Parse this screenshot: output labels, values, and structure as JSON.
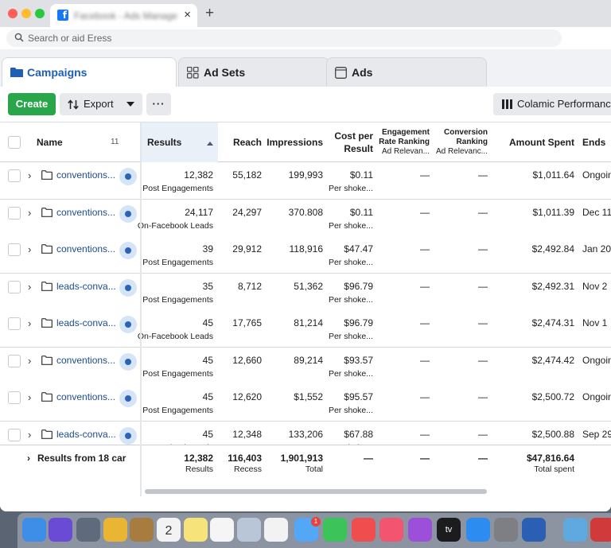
{
  "browser": {
    "tab_title": "Facebook - Ads Manager",
    "new_tab": "+",
    "close": "×",
    "address_placeholder": "Search or aid Eress"
  },
  "nav_tabs": [
    {
      "label": "Campaigns",
      "active": true
    },
    {
      "label": "Ad Sets",
      "active": false
    },
    {
      "label": "Ads",
      "active": false
    }
  ],
  "toolbar": {
    "create_label": "Create",
    "export_label": "Export",
    "more_label": "···",
    "columns_label": "Colamic Performance"
  },
  "table": {
    "headers": {
      "name": "Name",
      "name_count": "11",
      "results": "Results",
      "reach": "Reach",
      "impressions": "Impressions",
      "cost_per_result_1": "Cost per",
      "cost_per_result_2": "Result",
      "engagement_1": "Engagement",
      "engagement_2": "Rate Ranking",
      "engagement_3": "Ad Relevan...",
      "conversion_1": "Conversion",
      "conversion_2": "Ranking",
      "conversion_3": "Ad Relevanc...",
      "amount_spent": "Amount Spent",
      "ends": "Ends"
    },
    "rows": [
      {
        "name": "conventions...",
        "results": "12,382",
        "results_type": "Post Engagements",
        "reach": "55,182",
        "impressions": "199,993",
        "cost": "$0.11",
        "cost_sub": "Per shoke...",
        "engagement": "—",
        "conversion": "—",
        "spent": "$1,011.64",
        "ends": "Ongoin"
      },
      {
        "name": "conventions...",
        "results": "24,117",
        "results_type": "On-Facebook Leads",
        "reach": "24,297",
        "impressions": "370.808",
        "cost": "$0.11",
        "cost_sub": "Per shoke...",
        "engagement": "—",
        "conversion": "—",
        "spent": "$1,011.39",
        "ends": "Dec 11"
      },
      {
        "name": "conventions...",
        "results": "39",
        "results_type": "Post Engagements",
        "reach": "29,912",
        "impressions": "118,916",
        "cost": "$47.47",
        "cost_sub": "Per shoke...",
        "engagement": "—",
        "conversion": "—",
        "spent": "$2,492.84",
        "ends": "Jan 20"
      },
      {
        "name": "leads-conva...",
        "results": "35",
        "results_type": "Post Engagements",
        "reach": "8,712",
        "impressions": "51,362",
        "cost": "$96.79",
        "cost_sub": "Per shoke...",
        "engagement": "—",
        "conversion": "—",
        "spent": "$2,492.31",
        "ends": "Nov 2"
      },
      {
        "name": "leads-conva...",
        "results": "45",
        "results_type": "On-Facebook Leads",
        "reach": "17,765",
        "impressions": "81,214",
        "cost": "$96.79",
        "cost_sub": "Per shoke...",
        "engagement": "—",
        "conversion": "—",
        "spent": "$2,474.31",
        "ends": "Nov 1"
      },
      {
        "name": "conventions...",
        "results": "45",
        "results_type": "Post Engagements",
        "reach": "12,660",
        "impressions": "89,214",
        "cost": "$93.57",
        "cost_sub": "Per shoke...",
        "engagement": "—",
        "conversion": "—",
        "spent": "$2,474.42",
        "ends": "Ongoin"
      },
      {
        "name": "conventions...",
        "results": "45",
        "results_type": "Post Engagements",
        "reach": "12,620",
        "impressions": "$1,552",
        "cost": "$95.57",
        "cost_sub": "Per shoke...",
        "engagement": "—",
        "conversion": "—",
        "spent": "$2,500.72",
        "ends": "Ongoin"
      },
      {
        "name": "leads-conva...",
        "results": "45",
        "results_type": "On-Facebook Leads",
        "reach": "12,348",
        "impressions": "133,206",
        "cost": "$67.88",
        "cost_sub": "Per shoke...",
        "engagement": "—",
        "conversion": "—",
        "spent": "$2,500.88",
        "ends": "Sep 29"
      }
    ],
    "footer": {
      "label": "Results from 18 car",
      "results": "12,382",
      "results_sub": "Results",
      "reach": "116,403",
      "reach_sub": "Recess",
      "impressions": "1,901,913",
      "impressions_sub": "Total",
      "cost": "—",
      "engagement": "—",
      "conversion": "—",
      "spent": "$47,816.64",
      "spent_sub": "Total spent"
    }
  },
  "dock": {
    "calendar_day": "2",
    "messages_badge": "1",
    "tv_label": "tv"
  },
  "colors": {
    "accent_blue": "#1d5fb8",
    "create_green": "#2aa64a",
    "link_blue": "#1c4c8c"
  }
}
